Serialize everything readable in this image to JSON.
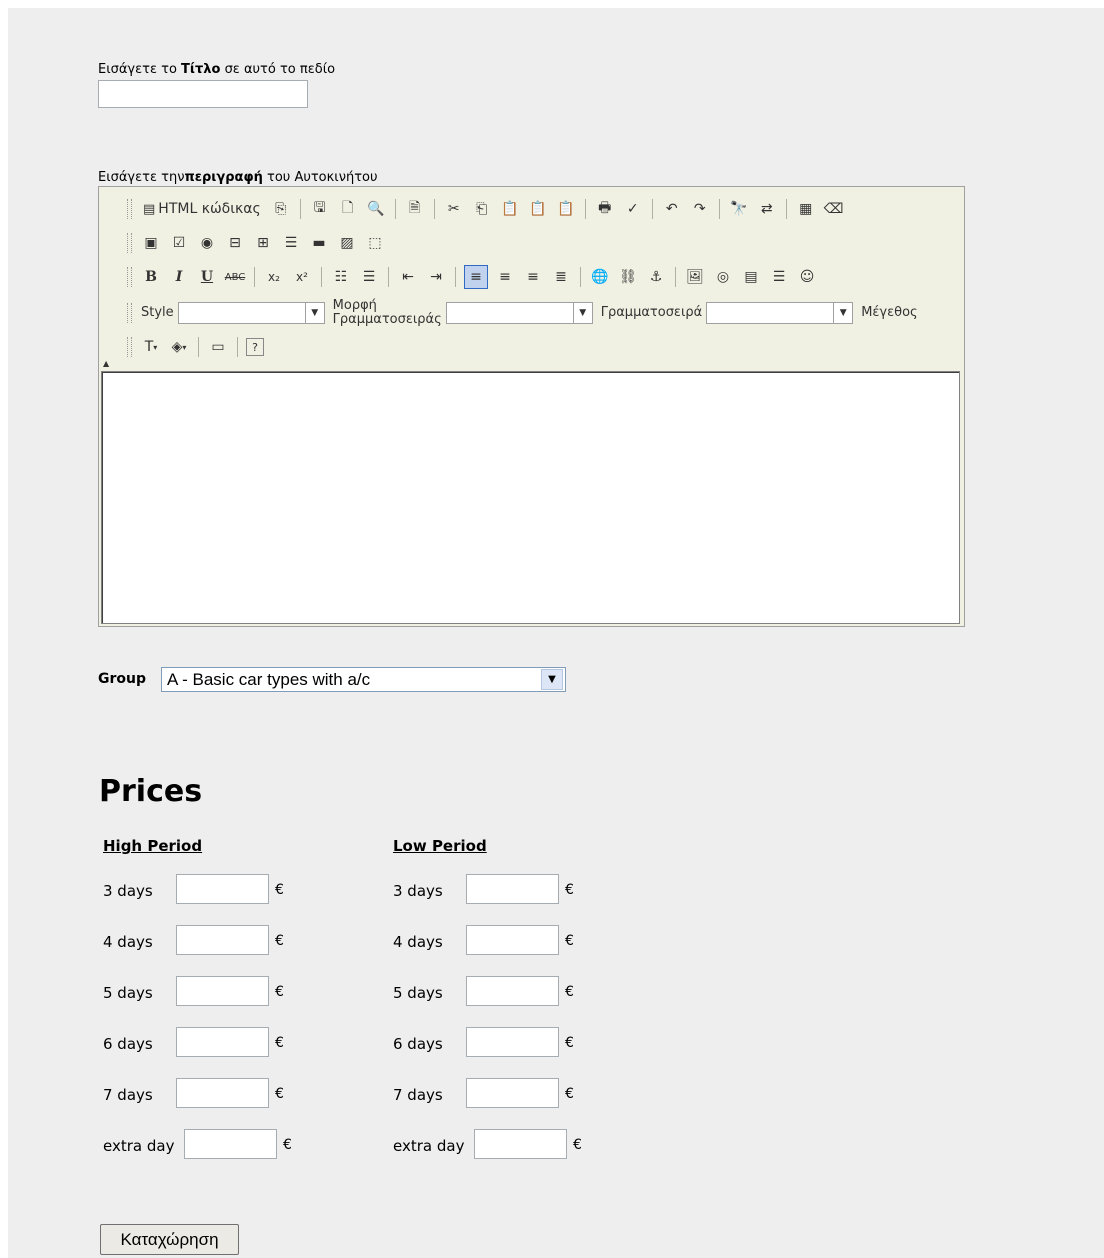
{
  "form": {
    "title_label_prefix": "Εισάγετε το ",
    "title_label_bold": "Τίτλο",
    "title_label_suffix": " σε αυτό το πεδίο",
    "title_value": "",
    "desc_label_prefix": "Εισάγετε την",
    "desc_label_bold": "περιγραφή",
    "desc_label_suffix": " του Αυτοκινήτου"
  },
  "editor": {
    "html_source_label": "HTML κώδικας",
    "style_label": "Style",
    "format_label_1": "Μορφή",
    "format_label_2": "Γραμματοσειράς",
    "font_label": "Γραμματοσειρά",
    "size_label": "Μέγεθος",
    "content": ""
  },
  "group": {
    "label": "Group",
    "selected": "A - Basic car types with a/c"
  },
  "prices": {
    "heading": "Prices",
    "currency": "€",
    "high_period": {
      "title": "High Period",
      "rows": [
        "3 days",
        "4 days",
        "5 days",
        "6 days",
        "7 days",
        "extra day"
      ]
    },
    "low_period": {
      "title": "Low Period",
      "rows": [
        "3 days",
        "4 days",
        "5 days",
        "6 days",
        "7 days",
        "extra day"
      ]
    }
  },
  "submit": {
    "label": "Καταχώρηση"
  }
}
